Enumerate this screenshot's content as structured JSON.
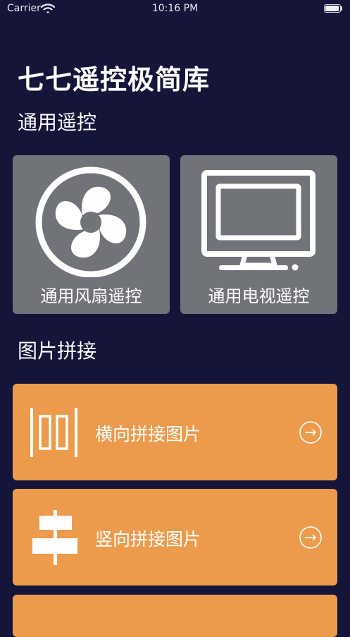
{
  "status_bar": {
    "carrier": "Carrier",
    "time": "10:16 PM"
  },
  "app": {
    "title": "七七遥控极简库"
  },
  "sections": {
    "remote": {
      "title": "通用遥控"
    },
    "stitch": {
      "title": "图片拼接"
    }
  },
  "cards": [
    {
      "label": "通用风扇遥控",
      "icon": "fan-icon"
    },
    {
      "label": "通用电视遥控",
      "icon": "tv-icon"
    }
  ],
  "rows": [
    {
      "label": "横向拼接图片",
      "icon": "horizontal-stitch-icon"
    },
    {
      "label": "竖向拼接图片",
      "icon": "vertical-stitch-icon"
    }
  ],
  "colors": {
    "background": "#15153a",
    "card": "#707479",
    "row": "#ec9b4d",
    "text": "#ffffff"
  }
}
